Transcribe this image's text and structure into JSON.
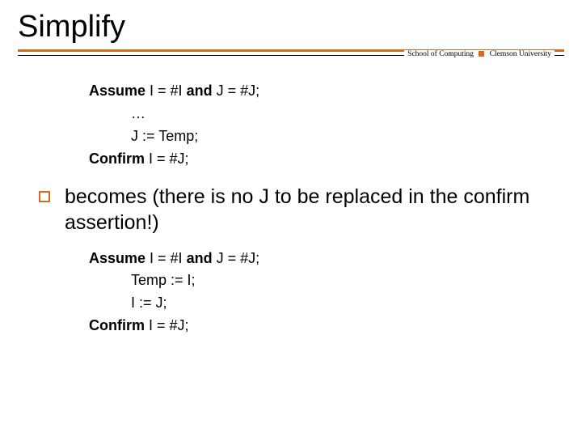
{
  "title": "Simplify",
  "subhead": {
    "left": "School of Computing",
    "right": "Clemson University"
  },
  "block1": {
    "assume_label": "Assume",
    "assume_expr_a": " I = #I ",
    "and_label": "and",
    "assume_expr_b": " J = #J;",
    "line_ellipsis": "…",
    "line_j": "J := Temp;",
    "confirm_label": "Confirm",
    "confirm_expr": " I = #J;"
  },
  "bullet_text": "becomes (there is no J to be replaced in the confirm assertion!)",
  "block2": {
    "assume_label": "Assume",
    "assume_expr_a": " I = #I ",
    "and_label": "and",
    "assume_expr_b": " J = #J;",
    "line_temp": "Temp := I;",
    "line_i": "I := J;",
    "confirm_label": "Confirm",
    "confirm_expr": " I = #J;"
  }
}
